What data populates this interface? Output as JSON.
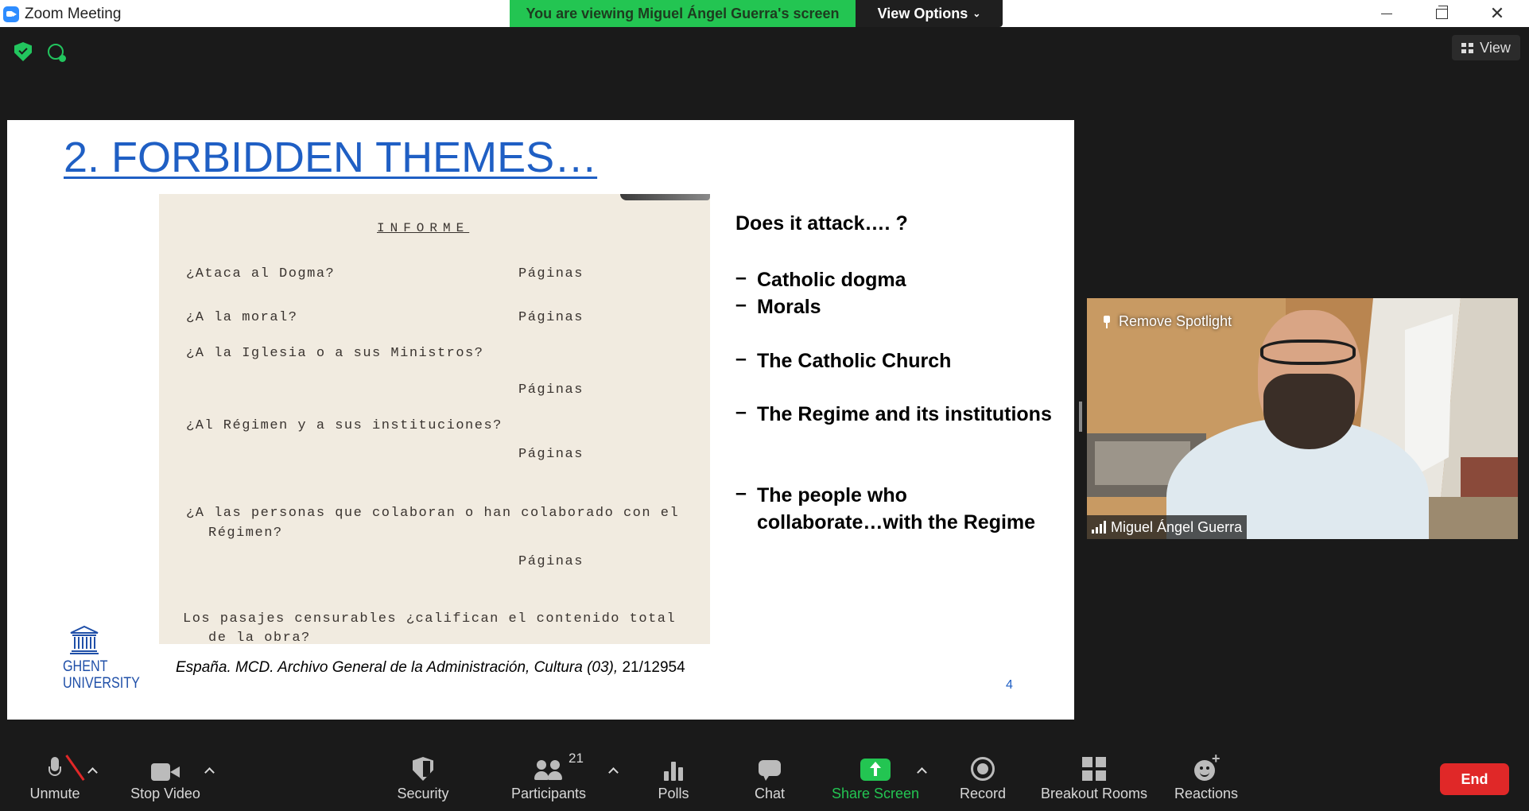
{
  "window": {
    "title": "Zoom Meeting",
    "share_banner": "You are viewing Miguel Ángel Guerra's screen",
    "view_options": "View Options",
    "view_button": "View"
  },
  "slide": {
    "title": "2. FORBIDDEN THEMES…",
    "document": {
      "heading": "INFORME",
      "lines": [
        "¿Ataca al Dogma?",
        "Páginas",
        "¿A la moral?",
        "Páginas",
        "¿A la Iglesia o a sus Ministros?",
        "Páginas",
        "¿Al Régimen y a sus instituciones?",
        "Páginas",
        "¿A las personas que colaboran o han colaborado con el",
        "Régimen?",
        "Páginas",
        "Los pasajes censurables ¿califican el contenido total",
        "de la obra?"
      ]
    },
    "attack_heading": "Does it attack…. ?",
    "bullets": [
      "Catholic dogma",
      "Morals",
      "The Catholic Church",
      "The Regime and its institutions",
      "The people who collaborate…with the Regime"
    ],
    "bullet_dash": "–",
    "logo": {
      "line1": "GHENT",
      "line2": "UNIVERSITY"
    },
    "citation_italic": "España. MCD. Archivo General de la Administración, Cultura (03), ",
    "citation_plain": "21/12954",
    "page_number": "4"
  },
  "video": {
    "remove_spotlight": "Remove Spotlight",
    "participant_name": "Miguel Ángel Guerra"
  },
  "toolbar": {
    "unmute": "Unmute",
    "stop_video": "Stop Video",
    "security": "Security",
    "participants": "Participants",
    "participants_count": "21",
    "polls": "Polls",
    "chat": "Chat",
    "share_screen": "Share Screen",
    "record": "Record",
    "breakout_rooms": "Breakout Rooms",
    "reactions": "Reactions",
    "end": "End"
  },
  "colors": {
    "accent_green": "#23c552",
    "end_red": "#e02828",
    "slide_title_blue": "#1f5fc4"
  }
}
